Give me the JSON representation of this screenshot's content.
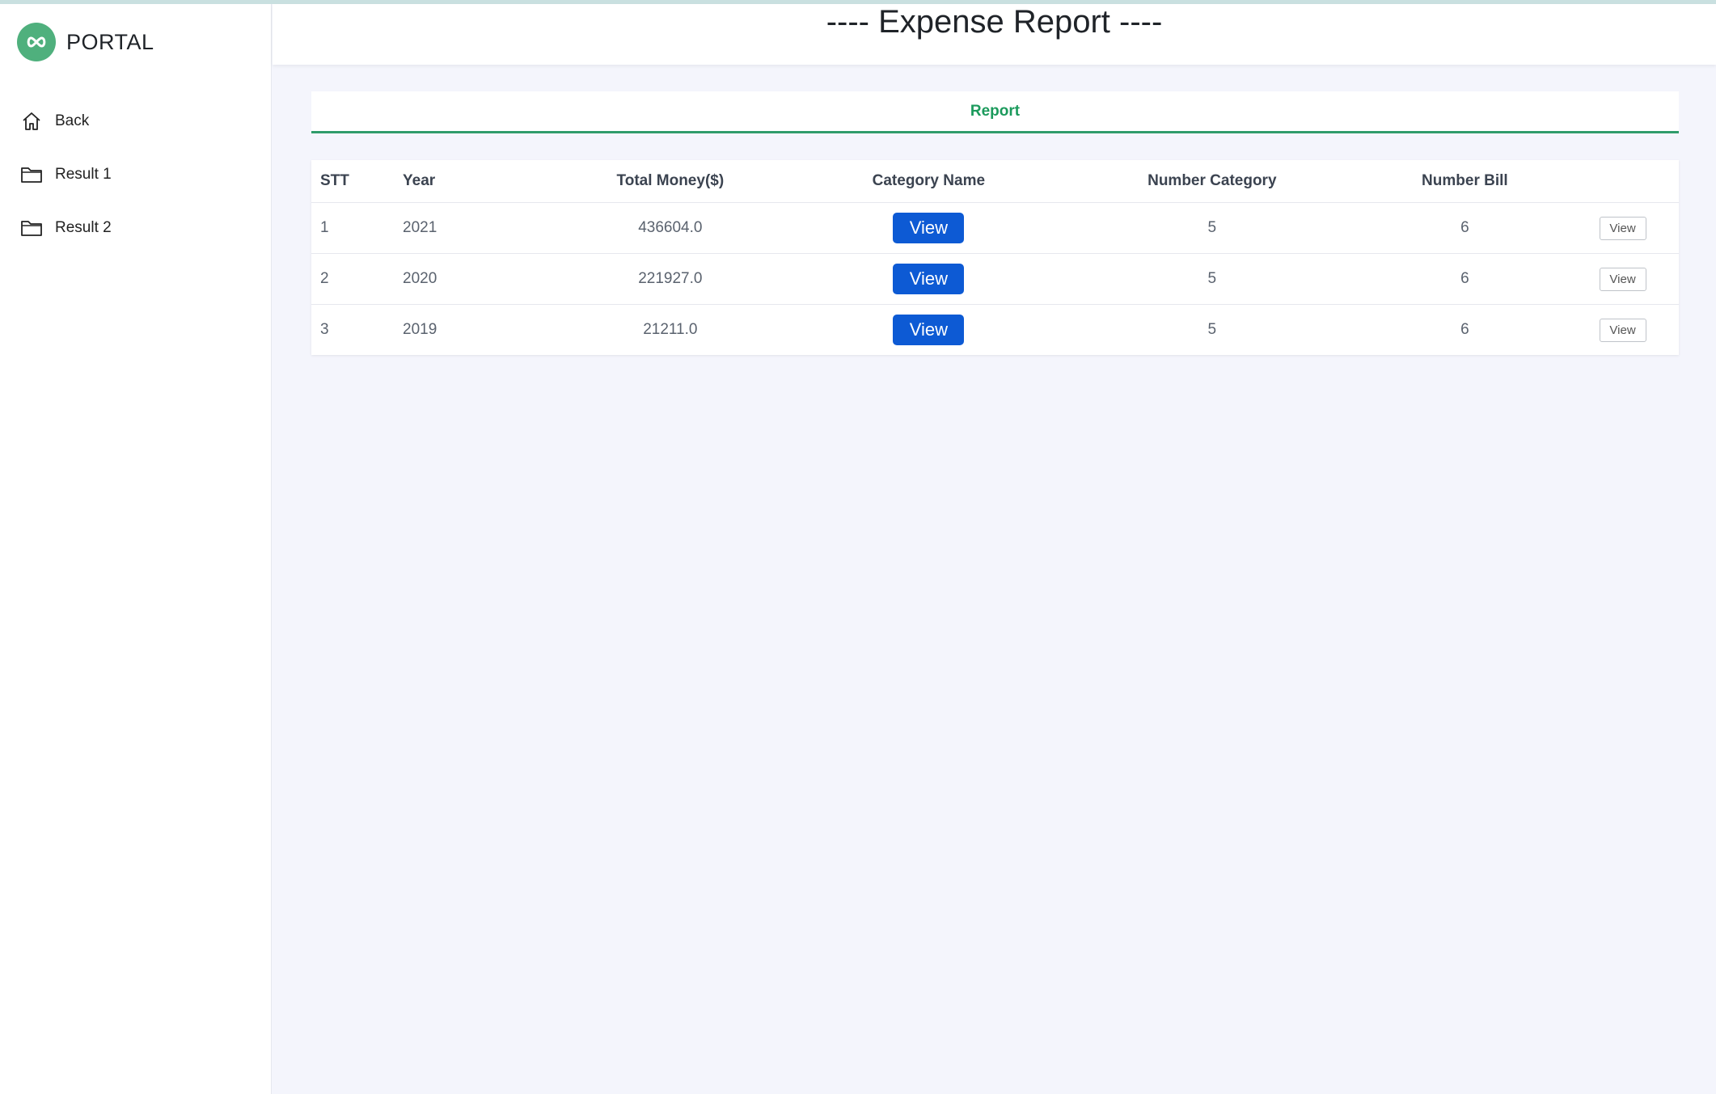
{
  "brand": {
    "name": "PORTAL",
    "logo_icon": "infinity-icon",
    "color": "#4fb07d"
  },
  "sidebar": {
    "items": [
      {
        "label": "Back",
        "icon": "home-icon"
      },
      {
        "label": "Result 1",
        "icon": "folder-icon"
      },
      {
        "label": "Result 2",
        "icon": "folder-icon"
      }
    ]
  },
  "header": {
    "title": "---- Expense Report ----"
  },
  "tabs": [
    {
      "label": "Report",
      "active": true
    }
  ],
  "table": {
    "headers": [
      "STT",
      "Year",
      "Total Money($)",
      "Category Name",
      "Number Category",
      "Number Bill",
      ""
    ],
    "rows": [
      {
        "stt": "1",
        "year": "2021",
        "total": "436604.0",
        "category_button": "View",
        "number_category": "5",
        "number_bill": "6",
        "action": "View"
      },
      {
        "stt": "2",
        "year": "2020",
        "total": "221927.0",
        "category_button": "View",
        "number_category": "5",
        "number_bill": "6",
        "action": "View"
      },
      {
        "stt": "3",
        "year": "2019",
        "total": "21211.0",
        "category_button": "View",
        "number_category": "5",
        "number_bill": "6",
        "action": "View"
      }
    ]
  },
  "colors": {
    "accent_green": "#1b9a5c",
    "primary_blue": "#0d5ad4",
    "background": "#f4f5fc"
  }
}
